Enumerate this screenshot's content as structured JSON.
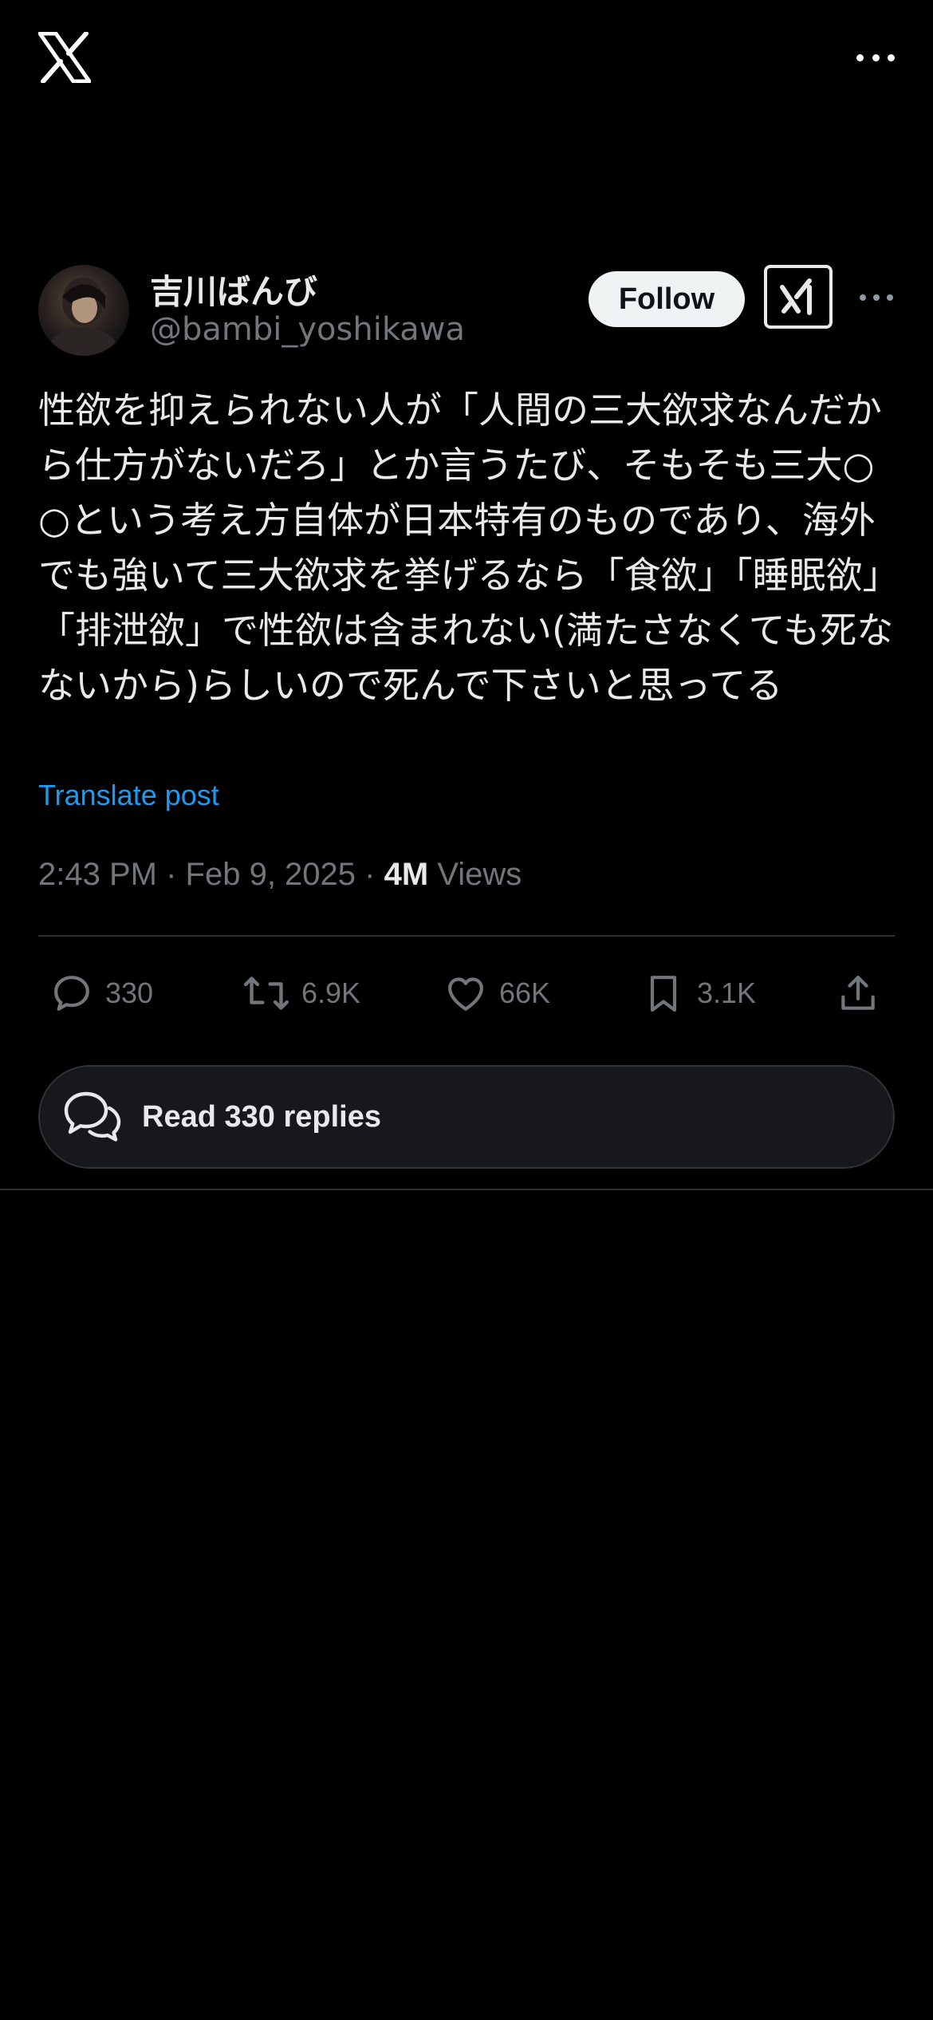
{
  "app": {
    "logo_icon": "x-logo-icon",
    "menu_icon": "more-horizontal-icon"
  },
  "author": {
    "display_name": "吉川ばんび",
    "handle": "@bambi_yoshikawa",
    "follow_label": "Follow",
    "grok_icon": "grok-icon",
    "more_icon": "more-horizontal-icon"
  },
  "post": {
    "text": "性欲を抑えられない人が「人間の三大欲求なんだから仕方がないだろ」とか言うたび、そもそも三大○○という考え方自体が日本特有のものであり、海外でも強いて三大欲求を挙げるなら「食欲」「睡眠欲」「排泄欲」で性欲は含まれない(満たさなくても死なないから)らしいので死んで下さいと思ってる",
    "translate_label": "Translate post",
    "time": "2:43 PM",
    "date": "Feb 9, 2025",
    "separator": "·",
    "views_count": "4M",
    "views_label": "Views"
  },
  "actions": {
    "replies": "330",
    "reposts": "6.9K",
    "likes": "66K",
    "bookmarks": "3.1K"
  },
  "read_replies": {
    "label": "Read 330 replies"
  },
  "colors": {
    "background": "#000000",
    "text": "#e7e9ea",
    "secondary": "#71767b",
    "link": "#1d9bf0"
  }
}
